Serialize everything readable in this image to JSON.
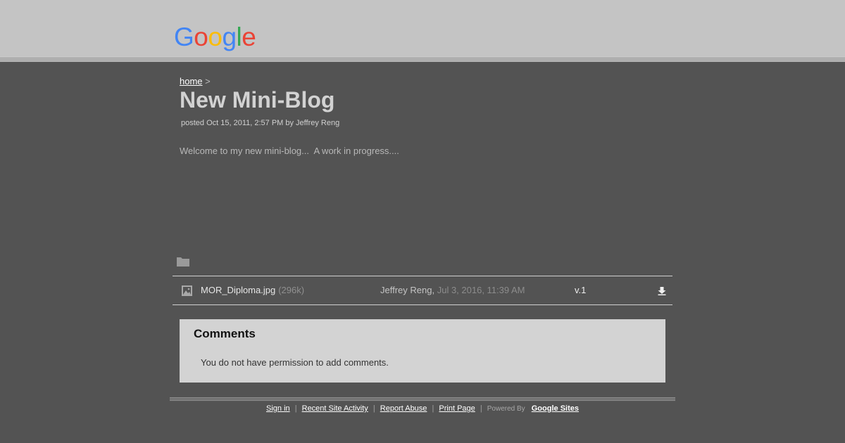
{
  "header": {
    "logo_letters": [
      {
        "char": "G",
        "color": "#4285F4"
      },
      {
        "char": "o",
        "color": "#EA4335"
      },
      {
        "char": "o",
        "color": "#FBBC05"
      },
      {
        "char": "g",
        "color": "#4285F4"
      },
      {
        "char": "l",
        "color": "#34A853"
      },
      {
        "char": "e",
        "color": "#EA4335"
      }
    ]
  },
  "breadcrumb": {
    "home_label": "home",
    "separator": ">"
  },
  "post": {
    "title": "New Mini-Blog",
    "meta": "posted Oct 15, 2011, 2:57 PM by Jeffrey Reng",
    "body": "Welcome to my new mini-blog...  A work in progress...."
  },
  "attachments": {
    "folder_icon": "folder-icon",
    "items": [
      {
        "icon": "image-icon",
        "name": "MOR_Diploma.jpg",
        "size": "(296k)",
        "author": "Jeffrey Reng,",
        "date": "Jul 3, 2016, 11:39 AM",
        "version": "v.1",
        "action_icon": "download-icon"
      }
    ]
  },
  "comments": {
    "title": "Comments",
    "message": "You do not have permission to add comments."
  },
  "footer": {
    "sign_in": "Sign in",
    "recent_activity": "Recent Site Activity",
    "report_abuse": "Report Abuse",
    "print_page": "Print Page",
    "separator": "|",
    "powered_by": "Powered By",
    "brand": "Google Sites"
  },
  "colors": {
    "page_bg": "#535353",
    "header_bg": "#c4c4c4",
    "comments_bg": "#d3d3d3"
  }
}
